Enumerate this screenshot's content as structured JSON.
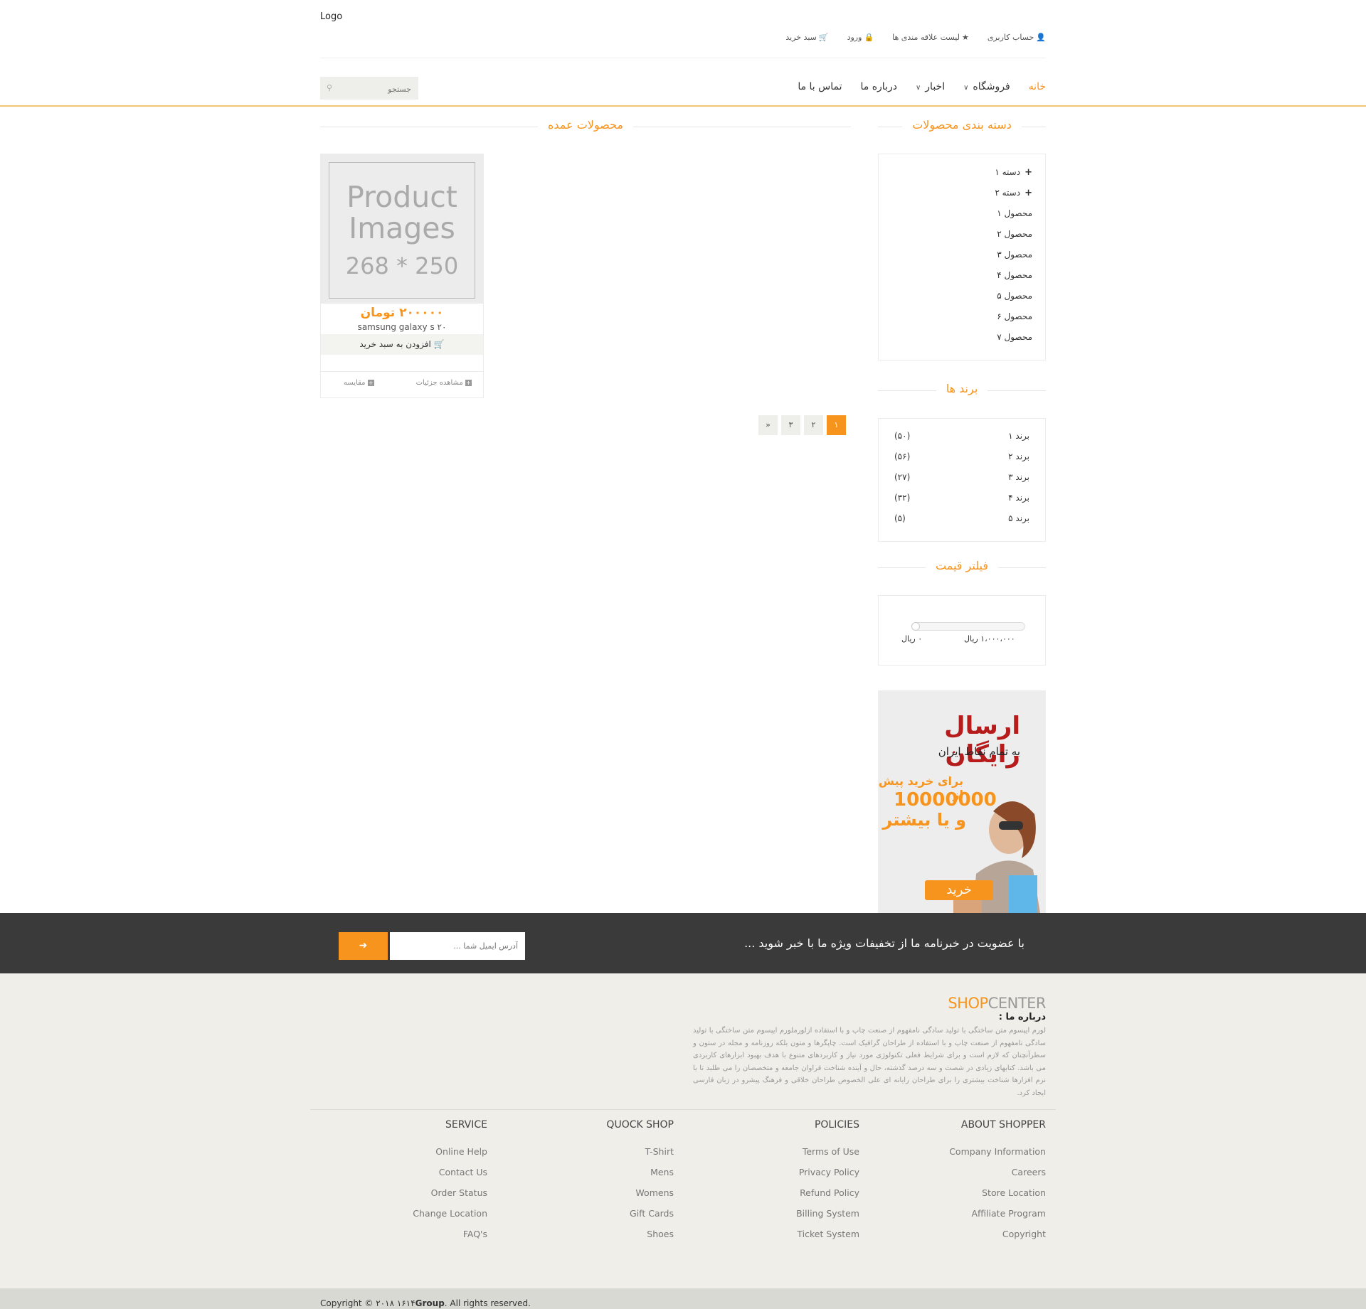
{
  "header": {
    "logo": "Logo",
    "topbar": [
      {
        "icon": "user-icon",
        "glyph": "👤",
        "label": "حساب کاربری"
      },
      {
        "icon": "star-icon",
        "glyph": "★",
        "label": "لیست علاقه مندی ها"
      },
      {
        "icon": "lock-icon",
        "glyph": "🔒",
        "label": "ورود"
      },
      {
        "icon": "cart-icon",
        "glyph": "🛒",
        "label": "سبد خرید"
      }
    ],
    "nav": [
      {
        "label": "خانه",
        "active": true
      },
      {
        "label": "فروشگاه",
        "dropdown": true
      },
      {
        "label": "اخبار",
        "dropdown": true
      },
      {
        "label": "درباره ما"
      },
      {
        "label": "تماس با ما"
      }
    ],
    "search_placeholder": "جستجو"
  },
  "sidebar": {
    "categories_title": "دسته بندی محصولات",
    "categories": [
      {
        "label": "دسته ۱",
        "expandable": true
      },
      {
        "label": "دسته ۲",
        "expandable": true
      },
      {
        "label": "محصول ۱"
      },
      {
        "label": "محصول ۲"
      },
      {
        "label": "محصول ۳"
      },
      {
        "label": "محصول ۴"
      },
      {
        "label": "محصول ۵"
      },
      {
        "label": "محصول ۶"
      },
      {
        "label": "محصول ۷"
      }
    ],
    "brands_title": "برند ها",
    "brands": [
      {
        "label": "برند ۱",
        "count": "(۵۰)"
      },
      {
        "label": "برند ۲",
        "count": "(۵۶)"
      },
      {
        "label": "برند ۳",
        "count": "(۲۷)"
      },
      {
        "label": "برند ۴",
        "count": "(۳۲)"
      },
      {
        "label": "برند ۵",
        "count": "(۵)"
      }
    ],
    "price_title": "فیلتر قیمت",
    "price_max": "۱،۰۰۰،۰۰۰ ریال",
    "price_min": "۰ ریال",
    "ad": {
      "line1": "ارسال رایگان",
      "line2": "به تمام نقاط ایران",
      "line3": "برای خرید پیش از",
      "line4": "10000000",
      "line5": "و یا بیشتر",
      "button": "خرید"
    }
  },
  "main": {
    "title": "محصولات عمده",
    "product": {
      "placeholder_line1": "Product",
      "placeholder_line2": "Images",
      "placeholder_size": "268 * 250",
      "price": "۲۰۰۰۰۰ تومان",
      "name": "samsung galaxy s ۲۰",
      "add_to_cart": "افزودن به سبد خرید",
      "details": "مشاهده جزئیات",
      "compare": "مقایسه"
    },
    "pagination": [
      "»",
      "۳",
      "۲",
      "۱"
    ],
    "current_page": "۱"
  },
  "newsletter": {
    "text": "با عضویت در خبرنامه ما از تخفیفات ویژه ما با خبر شوید ...",
    "placeholder": "آدرس ایمیل شما ..."
  },
  "footer": {
    "brand_shop": "SHOP",
    "brand_center": "CENTER",
    "about_title": "درباره ما :",
    "about_text": "لورم ایپسوم متن ساختگی با تولید سادگی نامفهوم از صنعت چاپ و با استفاده ازلورملورم ایپسوم متن ساختگی با تولید سادگی نامفهوم از صنعت چاپ و با استفاده از طراحان گرافیک است. چاپگرها و متون بلکه روزنامه و مجله در ستون و سطرآنچنان که لازم است و برای شرایط فعلی تکنولوژی مورد نیاز و کاربردهای متنوع با هدف بهبود ابزارهای کاربردی می باشد. کتابهای زیادی در شصت و سه درصد گذشته، حال و آینده شناخت فراوان جامعه و متخصصان را می طلبد تا با نرم افزارها شناخت بیشتری را برای طراحان رایانه ای علی الخصوص طراحان خلاقی و فرهنگ پیشرو در زبان فارسی ایجاد کرد.",
    "columns": [
      {
        "title": "ABOUT SHOPPER",
        "links": [
          "Company Information",
          "Careers",
          "Store Location",
          "Affiliate Program",
          "Copyright"
        ]
      },
      {
        "title": "POLICIES",
        "links": [
          "Terms of Use",
          "Privacy Policy",
          "Refund Policy",
          "Billing System",
          "Ticket System"
        ]
      },
      {
        "title": "QUOCK SHOP",
        "links": [
          "T-Shirt",
          "Mens",
          "Womens",
          "Gift Cards",
          "Shoes"
        ]
      },
      {
        "title": "SERVICE",
        "links": [
          "Online Help",
          "Contact Us",
          "Order Status",
          "Change Location",
          "FAQ's"
        ]
      }
    ],
    "copyright_prefix": "Copyright © ۲۰۱۸ ۱۶۱۴",
    "copyright_brand": "Group",
    "copyright_suffix": ". All rights reserved."
  },
  "colors": {
    "accent": "#f7941d",
    "dark": "#3a3a3a",
    "footer_bg": "#efeee8"
  }
}
